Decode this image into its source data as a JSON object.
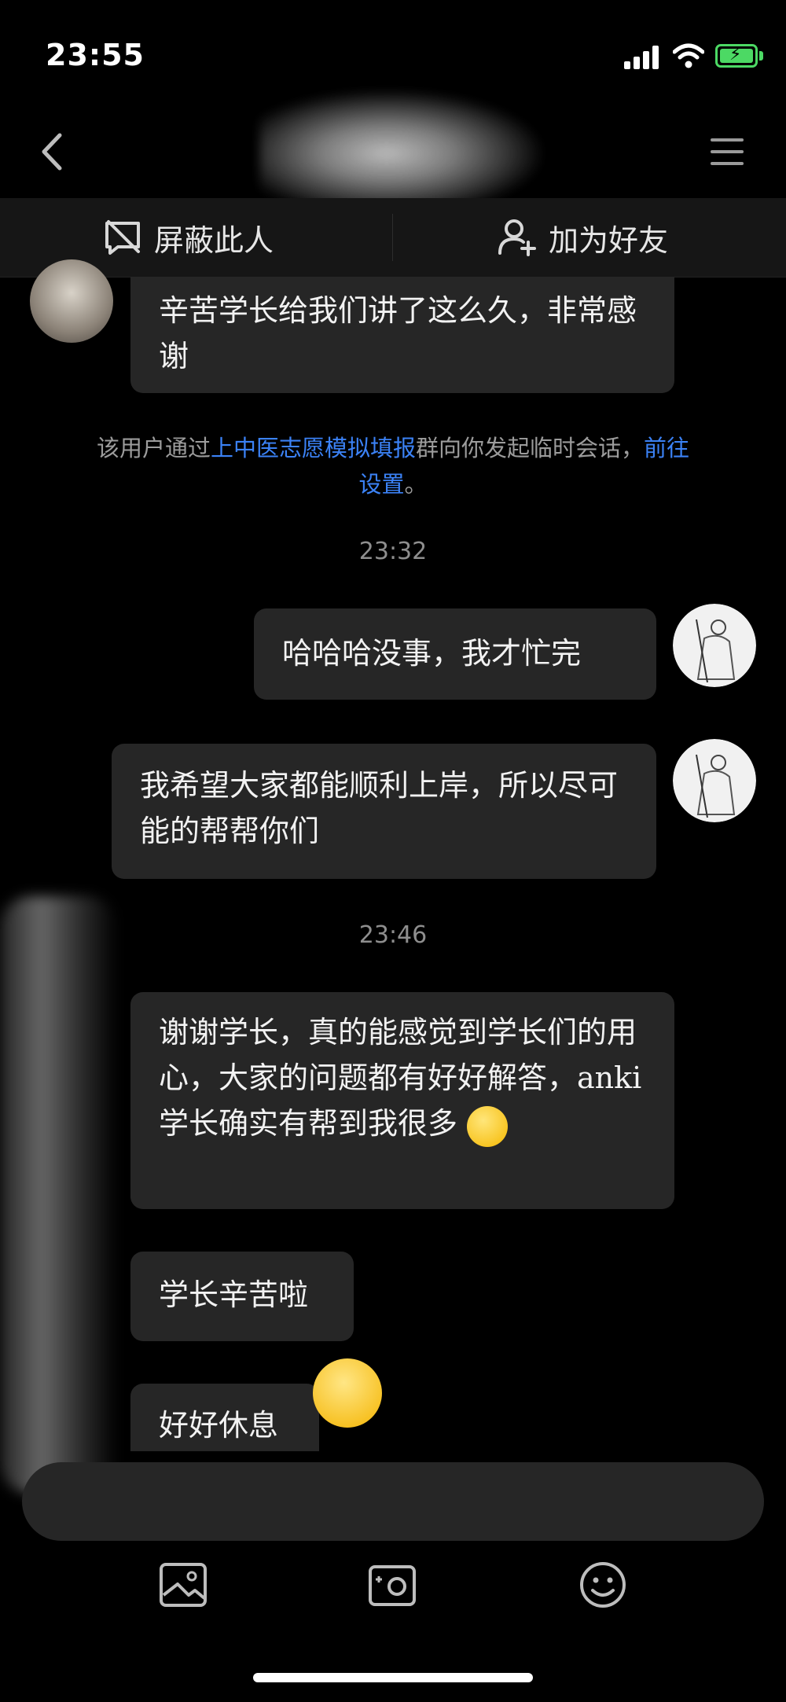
{
  "status_bar": {
    "time": "23:55"
  },
  "header": {
    "back_icon": "chevron-left-icon",
    "menu_icon": "hamburger-icon"
  },
  "actions": {
    "block": "屏蔽此人",
    "add_friend": "加为好友"
  },
  "messages": [
    {
      "side": "left",
      "text": "辛苦学长给我们讲了这么久，非常感谢"
    },
    {
      "side": "right",
      "text": "哈哈哈没事，我才忙完"
    },
    {
      "side": "right",
      "text": "我希望大家都能顺利上岸，所以尽可能的帮帮你们"
    },
    {
      "side": "left",
      "text": "谢谢学长，真的能感觉到学长们的用心，大家的问题都有好好解答，anki学长确实有帮到我很多"
    },
    {
      "side": "left",
      "text": "学长辛苦啦"
    },
    {
      "side": "left",
      "text": "好好休息"
    }
  ],
  "notice": {
    "prefix": "该用户通过",
    "group_link": "上中医志愿模拟填报",
    "middle": "群向你发起临时会话，",
    "settings_link_1": "前往",
    "settings_link_2": "设置",
    "suffix": "。"
  },
  "timestamps": [
    "23:32",
    "23:46"
  ],
  "toolbar": {
    "icons": [
      "image-icon",
      "camera-icon",
      "emoji-icon"
    ]
  },
  "colors": {
    "background": "#000000",
    "bubble": "#262626",
    "link": "#3b82f6",
    "battery": "#4cd964"
  }
}
